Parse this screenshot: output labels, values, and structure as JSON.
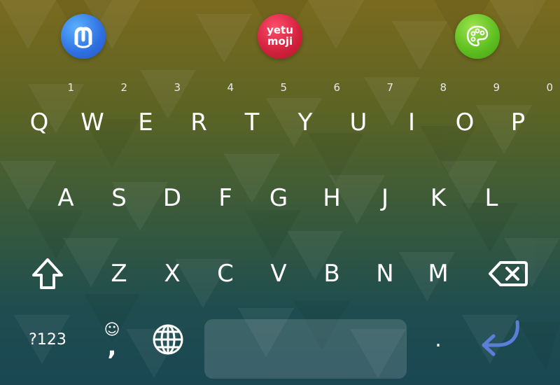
{
  "topbar": {
    "apps": [
      {
        "name": "Mastodon",
        "icon": "mastodon-logo-icon",
        "color": "#2e6fe0"
      },
      {
        "name": "yetu moji",
        "line1": "yetu",
        "line2": "moji",
        "color": "#d0203b"
      },
      {
        "name": "Themes",
        "icon": "palette-icon",
        "color": "#5bbd1e"
      }
    ]
  },
  "keys": {
    "row1": [
      {
        "label": "Q",
        "hint": "1"
      },
      {
        "label": "W",
        "hint": "2"
      },
      {
        "label": "E",
        "hint": "3"
      },
      {
        "label": "R",
        "hint": "4"
      },
      {
        "label": "T",
        "hint": "5"
      },
      {
        "label": "Y",
        "hint": "6"
      },
      {
        "label": "U",
        "hint": "7"
      },
      {
        "label": "I",
        "hint": "8"
      },
      {
        "label": "O",
        "hint": "9"
      },
      {
        "label": "P",
        "hint": "0"
      }
    ],
    "row2": [
      "A",
      "S",
      "D",
      "F",
      "G",
      "H",
      "J",
      "K",
      "L"
    ],
    "row3": [
      "Z",
      "X",
      "C",
      "V",
      "B",
      "N",
      "M"
    ],
    "row4": {
      "symbols": "?123",
      "emoji": "☺",
      "comma": ",",
      "period": "."
    }
  },
  "icons": {
    "shift": "shift-arrow-icon",
    "backspace": "backspace-icon",
    "globe": "globe-icon",
    "enter": "enter-arrow-icon",
    "enter_color": "#5a7fd8"
  }
}
